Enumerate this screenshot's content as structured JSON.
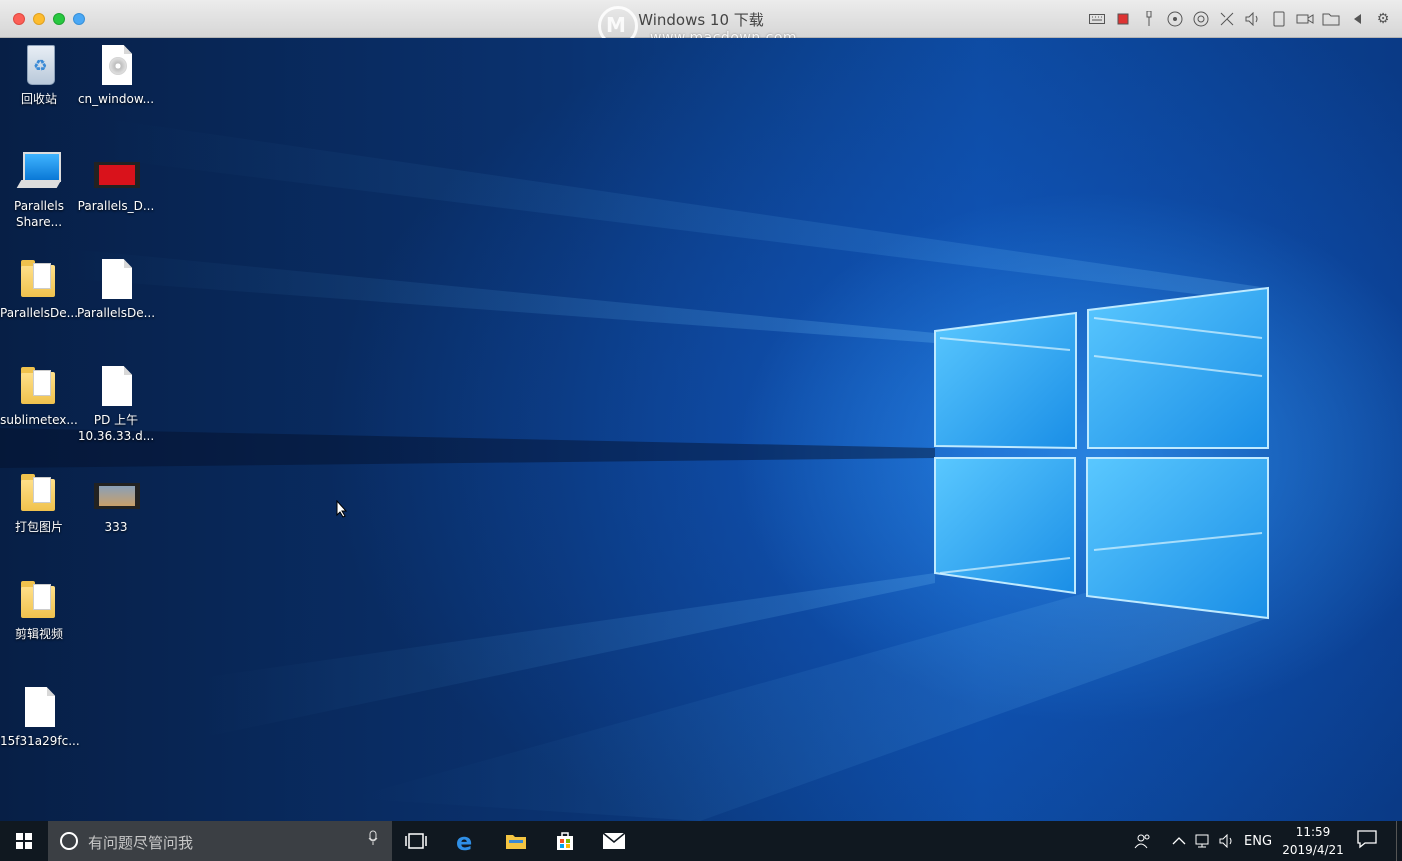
{
  "window": {
    "title": "Windows 10 下载",
    "watermark_url": "www.macdown.com"
  },
  "toolbar_icons": [
    "keyboard-icon",
    "cpu-icon",
    "usb-icon",
    "cd-icon",
    "camera-icon",
    "network-icon",
    "sound-icon",
    "device-icon",
    "video-icon",
    "shared-folder-icon",
    "back-arrow-icon",
    "gear-icon"
  ],
  "desktop": {
    "icons": [
      {
        "label": "回收站",
        "type": "recycle-bin"
      },
      {
        "label": "cn_window...",
        "type": "disc-file"
      },
      {
        "label": "Parallels\nShare...",
        "type": "monitor"
      },
      {
        "label": "Parallels_D...",
        "type": "video"
      },
      {
        "label": "ParallelsDe...",
        "type": "folder"
      },
      {
        "label": "ParallelsDe...",
        "type": "file"
      },
      {
        "label": "sublimetex...",
        "type": "folder"
      },
      {
        "label": "PD 上午\n10.36.33.d...",
        "type": "file"
      },
      {
        "label": "打包图片",
        "type": "folder"
      },
      {
        "label": "333",
        "type": "video"
      },
      {
        "label": "剪辑视频",
        "type": "folder"
      },
      {
        "label": "15f31a29fc...",
        "type": "file"
      }
    ]
  },
  "taskbar": {
    "search_placeholder": "有问题尽管问我",
    "pinned": [
      "task-view-icon",
      "edge-icon",
      "file-explorer-icon",
      "store-icon",
      "mail-icon"
    ],
    "language": "ENG",
    "time": "11:59",
    "date": "2019/4/21"
  },
  "colors": {
    "accent": "#0a78d6",
    "taskbar": "#101820",
    "search_box": "#3b3f44"
  }
}
